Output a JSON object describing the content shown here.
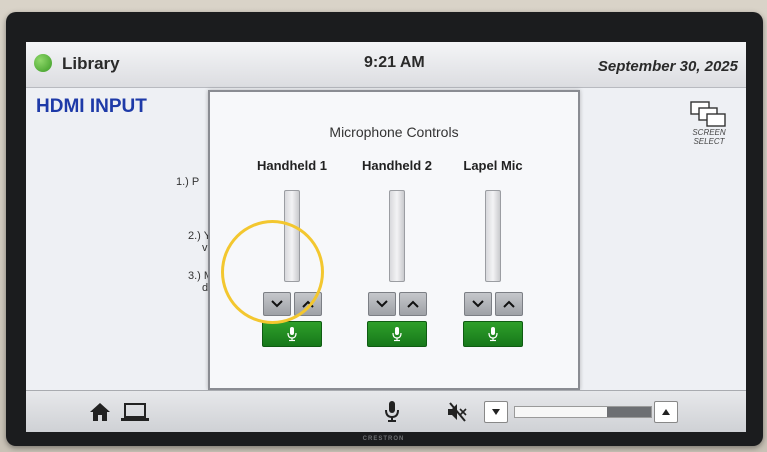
{
  "header": {
    "room_name": "Library",
    "time": "9:21 AM",
    "date": "September 30, 2025",
    "status_color": "#3a9a24"
  },
  "main": {
    "source_title": "HDMI INPUT",
    "screen_select": {
      "line1": "SCREEN",
      "line2": "SELECT",
      "icon": "screens-icon"
    },
    "steps": [
      "1.) P",
      "2.) Y",
      "v",
      "3.) M",
      "de"
    ]
  },
  "popup": {
    "title": "Microphone Controls",
    "channels": [
      {
        "name": "Handheld 1",
        "down_icon": "chevron-down-icon",
        "up_icon": "chevron-up-icon",
        "mic_icon": "microphone-icon"
      },
      {
        "name": "Handheld 2",
        "down_icon": "chevron-down-icon",
        "up_icon": "chevron-up-icon",
        "mic_icon": "microphone-icon"
      },
      {
        "name": "Lapel Mic",
        "down_icon": "chevron-down-icon",
        "up_icon": "chevron-up-icon",
        "mic_icon": "microphone-icon"
      }
    ],
    "mic_button_color": "#1f8a1f",
    "highlight_color": "#f3c72f"
  },
  "bottom_bar": {
    "icons": [
      "home-icon",
      "laptop-icon",
      "microphone-icon",
      "mute-icon",
      "volume-down-icon",
      "volume-up-icon"
    ],
    "volume_level": 0.68
  },
  "brand": "CRESTRON"
}
